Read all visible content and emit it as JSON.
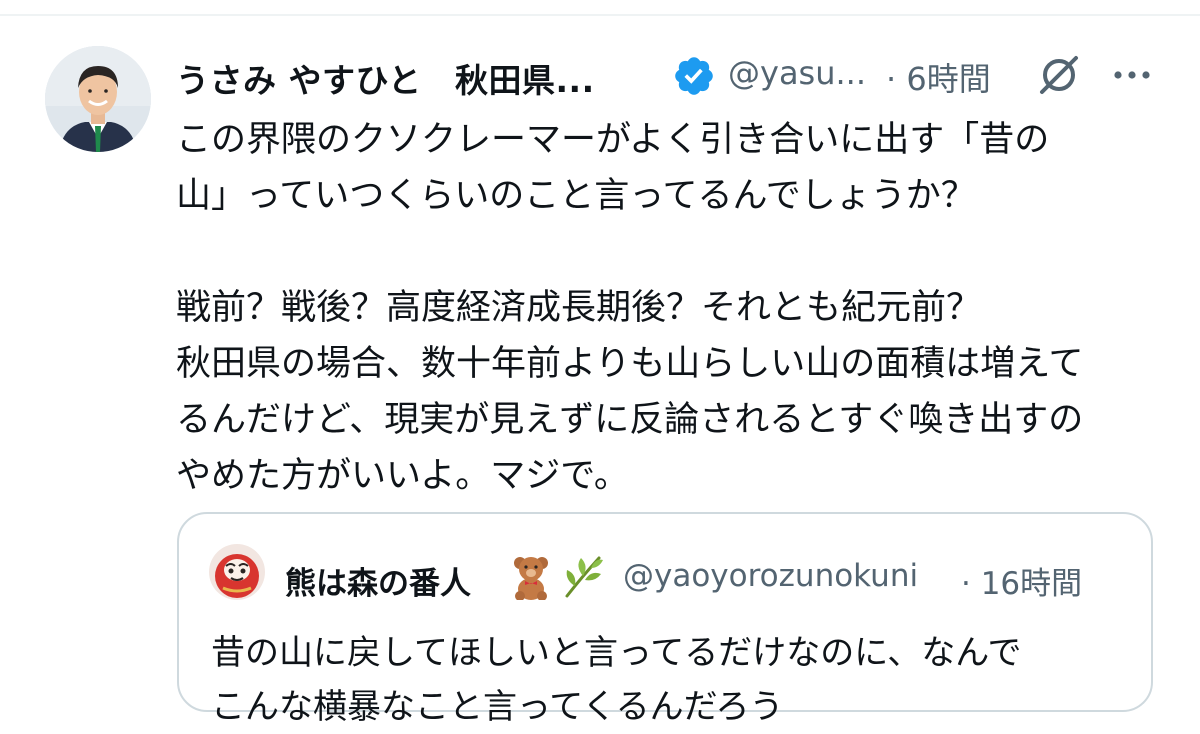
{
  "tweet": {
    "display_name": "うさみ やすひと　秋田県...",
    "handle": "@yasu...",
    "time": "· 6時間",
    "verified_icon": "verified-badge-icon",
    "grok_icon": "grok-icon",
    "more_icon": "more-options-icon",
    "text": "この界隈のクソクレーマーがよく引き合いに出す「昔の\n山」っていつくらいのこと言ってるんでしょうか？\n\n戦前？戦後？高度経済成長期後？それとも紀元前？\n秋田県の場合、数十年前よりも山らしい山の面積は増えて\nるんだけど、現実が見えずに反論されるとすぐ喚き出すの\nやめた方がいいよ。マジで。"
  },
  "quote": {
    "display_name": "熊は森の番人",
    "emoji1": "teddy-bear-icon",
    "emoji2": "herb-icon",
    "handle": "@yaoyorozunokuni",
    "time": "· 16時間",
    "text": "昔の山に戻してほしいと言ってるだけなのに、なんで\nこんな横暴なこと言ってくるんだろう"
  },
  "colors": {
    "text": "#0f1419",
    "secondary": "#536471",
    "verified": "#1d9bf0",
    "border": "#cfd9de"
  }
}
